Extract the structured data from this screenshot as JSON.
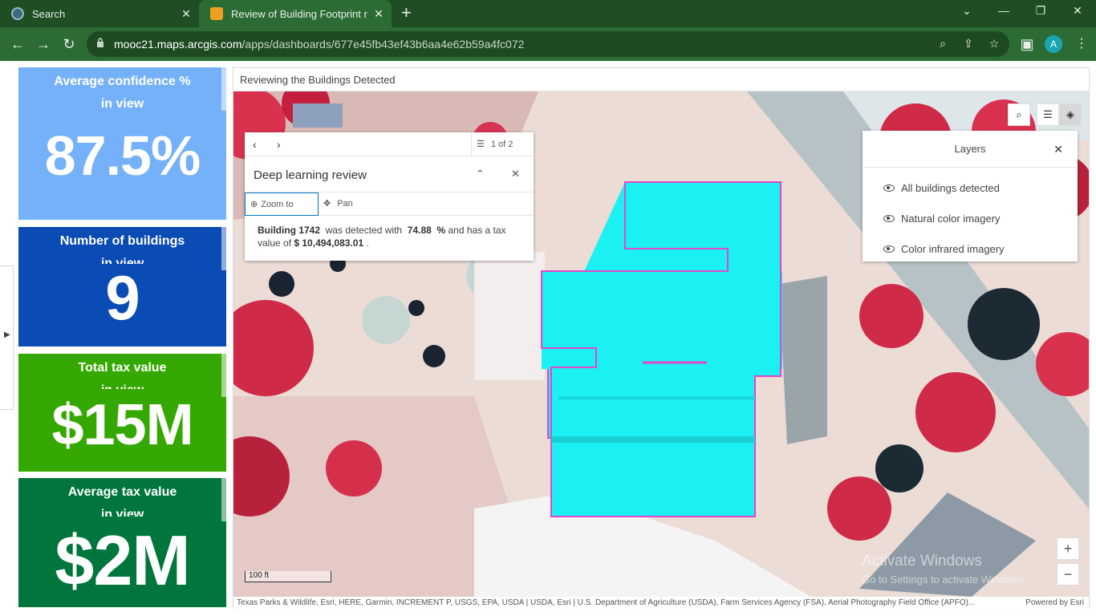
{
  "browser": {
    "tabs": [
      {
        "label": "Search"
      },
      {
        "label": "Review of Building Footprint res"
      }
    ],
    "url_host": "mooc21.maps.arcgis.com",
    "url_path": "/apps/dashboards/677e45fb43ef43b6aa4e62b59a4fc072",
    "avatar_letter": "A",
    "accent_color": "#2c6b34"
  },
  "cards": [
    {
      "title": "Average confidence %",
      "subtitle": "in view",
      "value": "87.5%",
      "color": "#75b1f9"
    },
    {
      "title": "Number of buildings",
      "subtitle": "in view",
      "value": "9",
      "color": "#0a4bb4"
    },
    {
      "title": "Total tax value",
      "subtitle": "in view",
      "value": "$15M",
      "color": "#35a800"
    },
    {
      "title": "Average tax value",
      "subtitle": "in view",
      "value": "$2M",
      "color": "#00763d"
    }
  ],
  "map": {
    "title": "Reviewing the Buildings Detected",
    "scale_label": "100 ft",
    "attribution": "Texas Parks & Wildlife, Esri, HERE, Garmin, INCREMENT P, USGS, EPA, USDA | USDA, Esri | U.S. Department of Agriculture (USDA), Farm Services Agency (FSA), Aerial Photography Field Office (APFO)...",
    "powered_by": "Powered by Esri",
    "popup": {
      "page_count": "1 of 2",
      "title": "Deep learning review",
      "zoom_label": "Zoom to",
      "pan_label": "Pan",
      "building_label": "Building 1742",
      "detected_text": "was detected with",
      "confidence": "74.88",
      "percent_text": "%",
      "and_text": "and has a",
      "tax_text": "tax value of",
      "tax_value": "$ 10,494,083.01",
      "end_text": "."
    },
    "layers_panel": {
      "title": "Layers",
      "items": [
        {
          "label": "All buildings detected"
        },
        {
          "label": "Natural color imagery"
        },
        {
          "label": "Color infrared imagery"
        }
      ]
    },
    "zoom_in": "+",
    "zoom_out": "−",
    "watermark_title": "Activate Windows",
    "watermark_sub": "Go to Settings to activate Windows."
  }
}
